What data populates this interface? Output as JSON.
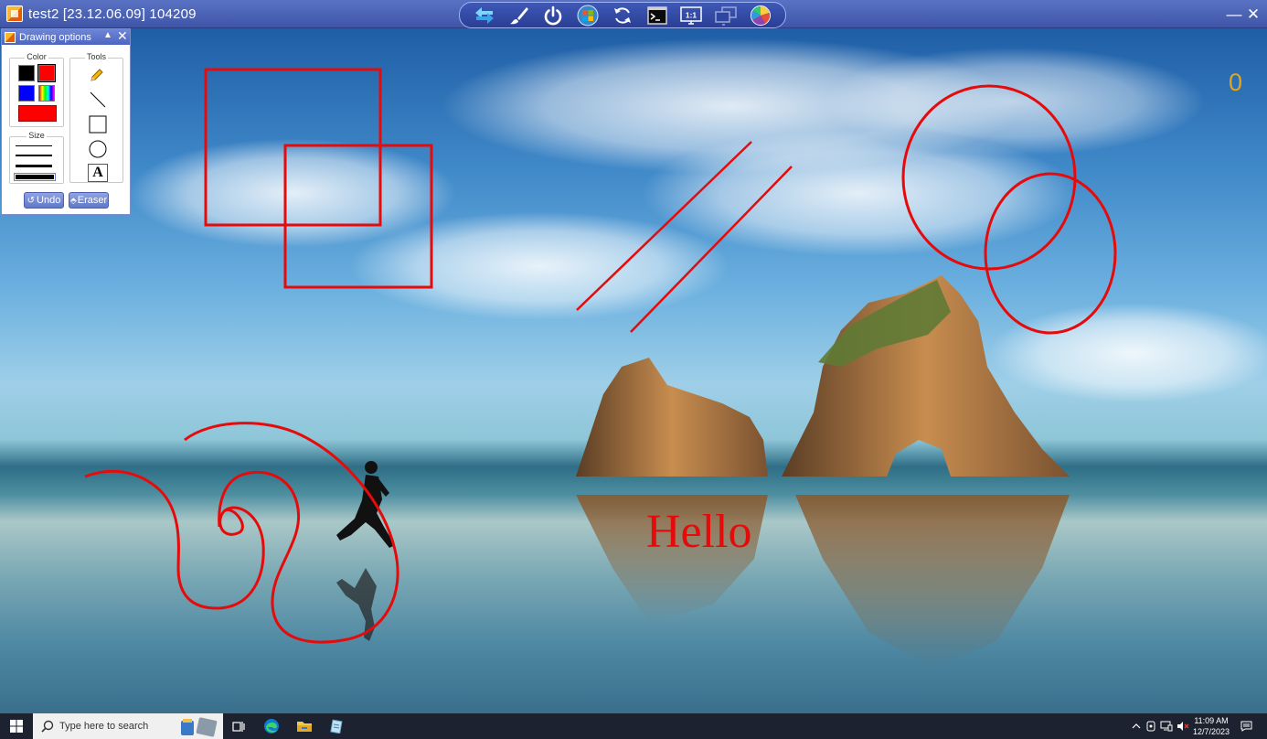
{
  "window": {
    "title": "test2 [23.12.06.09] 104209",
    "minimize_label": "—",
    "close_label": "✕"
  },
  "toolbar": {
    "icons": [
      "switch-sides-icon",
      "drawing-brush-icon",
      "power-icon",
      "windows-start-icon",
      "refresh-icon",
      "command-prompt-icon",
      "actual-size-icon",
      "multi-monitor-icon",
      "color-depth-icon"
    ],
    "actual_size_label": "1:1"
  },
  "desktop": {
    "counter": "0",
    "annotation_text": "Hello",
    "annotation_color": "#e50b0b"
  },
  "drawing_panel": {
    "title": "Drawing options",
    "color_label": "Color",
    "tools_label": "Tools",
    "size_label": "Size",
    "colors": {
      "black": "#000000",
      "red": "#ff0000",
      "blue": "#0000ff",
      "selected": "#ff0000"
    },
    "text_tool_glyph": "A",
    "undo_label": "Undo",
    "eraser_label": "Eraser"
  },
  "taskbar": {
    "search_placeholder": "Type here to search",
    "time": "11:09 AM",
    "date": "12/7/2023"
  }
}
